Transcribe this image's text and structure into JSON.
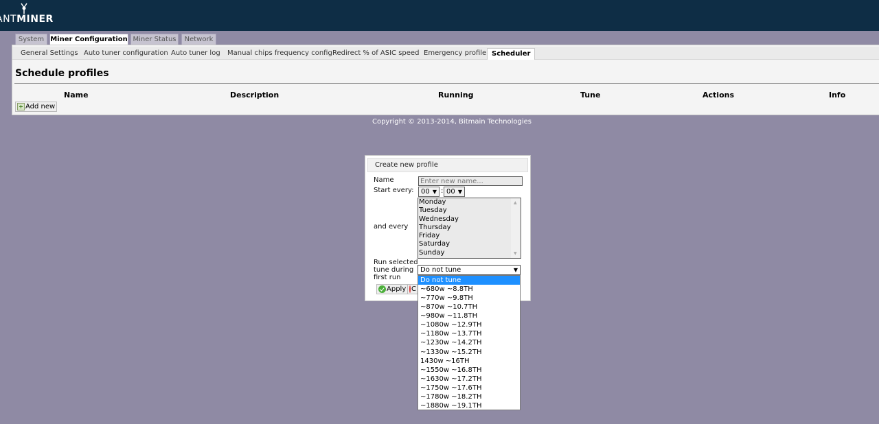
{
  "header": {
    "logo_light": "ANT",
    "logo_bold": "MINER"
  },
  "main_tabs": [
    "System",
    "Miner Configuration",
    "Miner Status",
    "Network"
  ],
  "active_main_tab": "Miner Configuration",
  "sub_tabs": [
    "General Settings",
    "Auto tuner configuration",
    "Auto tuner log",
    "Manual chips frequency config",
    "Redirect % of ASIC speed",
    "Emergency profile",
    "Scheduler"
  ],
  "active_sub_tab": "Scheduler",
  "page": {
    "title": "Schedule profiles",
    "columns": [
      "Name",
      "Description",
      "Running",
      "Tune",
      "Actions",
      "Info"
    ],
    "add_new_label": "Add new"
  },
  "footer": {
    "copyright": "Copyright © 2013-2014, Bitmain Technologies"
  },
  "dialog": {
    "title": "Create new profile",
    "name_label": "Name",
    "name_placeholder": "Enter new name...",
    "start_label": "Start every:",
    "start_hour": "00",
    "start_minute": "00",
    "time_separator": ":",
    "and_every_label": "and every",
    "days": [
      "Monday",
      "Tuesday",
      "Wednesday",
      "Thursday",
      "Friday",
      "Saturday",
      "Sunday"
    ],
    "run_label_1": "Run selected",
    "run_label_2": "tune during",
    "run_label_3": "first run",
    "tune_selected": "Do not tune",
    "apply_label": "Apply",
    "cancel_label_visible": "C"
  },
  "tune_options": [
    "Do not tune",
    "~680w ~8.8TH",
    "~770w ~9.8TH",
    "~870w ~10.7TH",
    "~980w ~11.8TH",
    "~1080w ~12.9TH",
    "~1180w ~13.7TH",
    "~1230w ~14.2TH",
    "~1330w ~15.2TH",
    "1430w ~16TH",
    "~1550w ~16.8TH",
    "~1630w ~17.2TH",
    "~1750w ~17.6TH",
    "~1780w ~18.2TH",
    "~1880w ~19.1TH"
  ],
  "colors": {
    "header_bg": "#0e2d45",
    "page_bg": "#8f8aa4",
    "selected_option": "#1e90ff"
  }
}
